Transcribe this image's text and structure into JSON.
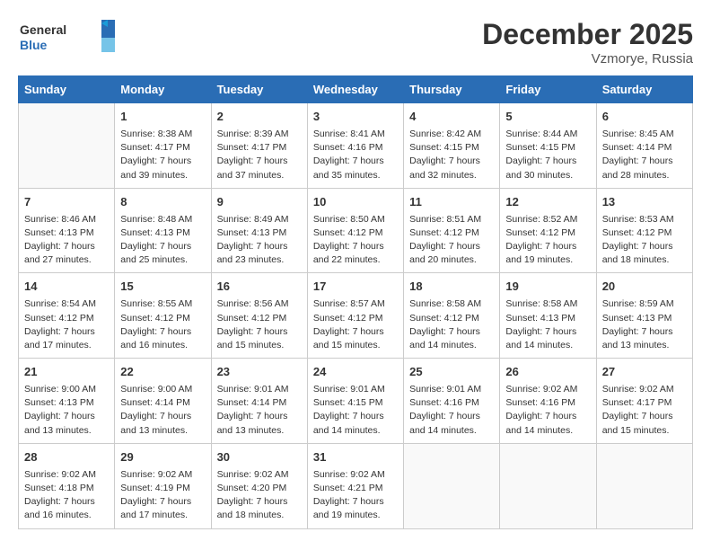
{
  "logo": {
    "line1": "General",
    "line2": "Blue"
  },
  "title": "December 2025",
  "location": "Vzmorye, Russia",
  "days_of_week": [
    "Sunday",
    "Monday",
    "Tuesday",
    "Wednesday",
    "Thursday",
    "Friday",
    "Saturday"
  ],
  "weeks": [
    [
      {
        "day": "",
        "info": ""
      },
      {
        "day": "1",
        "info": "Sunrise: 8:38 AM\nSunset: 4:17 PM\nDaylight: 7 hours\nand 39 minutes."
      },
      {
        "day": "2",
        "info": "Sunrise: 8:39 AM\nSunset: 4:17 PM\nDaylight: 7 hours\nand 37 minutes."
      },
      {
        "day": "3",
        "info": "Sunrise: 8:41 AM\nSunset: 4:16 PM\nDaylight: 7 hours\nand 35 minutes."
      },
      {
        "day": "4",
        "info": "Sunrise: 8:42 AM\nSunset: 4:15 PM\nDaylight: 7 hours\nand 32 minutes."
      },
      {
        "day": "5",
        "info": "Sunrise: 8:44 AM\nSunset: 4:15 PM\nDaylight: 7 hours\nand 30 minutes."
      },
      {
        "day": "6",
        "info": "Sunrise: 8:45 AM\nSunset: 4:14 PM\nDaylight: 7 hours\nand 28 minutes."
      }
    ],
    [
      {
        "day": "7",
        "info": "Sunrise: 8:46 AM\nSunset: 4:13 PM\nDaylight: 7 hours\nand 27 minutes."
      },
      {
        "day": "8",
        "info": "Sunrise: 8:48 AM\nSunset: 4:13 PM\nDaylight: 7 hours\nand 25 minutes."
      },
      {
        "day": "9",
        "info": "Sunrise: 8:49 AM\nSunset: 4:13 PM\nDaylight: 7 hours\nand 23 minutes."
      },
      {
        "day": "10",
        "info": "Sunrise: 8:50 AM\nSunset: 4:12 PM\nDaylight: 7 hours\nand 22 minutes."
      },
      {
        "day": "11",
        "info": "Sunrise: 8:51 AM\nSunset: 4:12 PM\nDaylight: 7 hours\nand 20 minutes."
      },
      {
        "day": "12",
        "info": "Sunrise: 8:52 AM\nSunset: 4:12 PM\nDaylight: 7 hours\nand 19 minutes."
      },
      {
        "day": "13",
        "info": "Sunrise: 8:53 AM\nSunset: 4:12 PM\nDaylight: 7 hours\nand 18 minutes."
      }
    ],
    [
      {
        "day": "14",
        "info": "Sunrise: 8:54 AM\nSunset: 4:12 PM\nDaylight: 7 hours\nand 17 minutes."
      },
      {
        "day": "15",
        "info": "Sunrise: 8:55 AM\nSunset: 4:12 PM\nDaylight: 7 hours\nand 16 minutes."
      },
      {
        "day": "16",
        "info": "Sunrise: 8:56 AM\nSunset: 4:12 PM\nDaylight: 7 hours\nand 15 minutes."
      },
      {
        "day": "17",
        "info": "Sunrise: 8:57 AM\nSunset: 4:12 PM\nDaylight: 7 hours\nand 15 minutes."
      },
      {
        "day": "18",
        "info": "Sunrise: 8:58 AM\nSunset: 4:12 PM\nDaylight: 7 hours\nand 14 minutes."
      },
      {
        "day": "19",
        "info": "Sunrise: 8:58 AM\nSunset: 4:13 PM\nDaylight: 7 hours\nand 14 minutes."
      },
      {
        "day": "20",
        "info": "Sunrise: 8:59 AM\nSunset: 4:13 PM\nDaylight: 7 hours\nand 13 minutes."
      }
    ],
    [
      {
        "day": "21",
        "info": "Sunrise: 9:00 AM\nSunset: 4:13 PM\nDaylight: 7 hours\nand 13 minutes."
      },
      {
        "day": "22",
        "info": "Sunrise: 9:00 AM\nSunset: 4:14 PM\nDaylight: 7 hours\nand 13 minutes."
      },
      {
        "day": "23",
        "info": "Sunrise: 9:01 AM\nSunset: 4:14 PM\nDaylight: 7 hours\nand 13 minutes."
      },
      {
        "day": "24",
        "info": "Sunrise: 9:01 AM\nSunset: 4:15 PM\nDaylight: 7 hours\nand 14 minutes."
      },
      {
        "day": "25",
        "info": "Sunrise: 9:01 AM\nSunset: 4:16 PM\nDaylight: 7 hours\nand 14 minutes."
      },
      {
        "day": "26",
        "info": "Sunrise: 9:02 AM\nSunset: 4:16 PM\nDaylight: 7 hours\nand 14 minutes."
      },
      {
        "day": "27",
        "info": "Sunrise: 9:02 AM\nSunset: 4:17 PM\nDaylight: 7 hours\nand 15 minutes."
      }
    ],
    [
      {
        "day": "28",
        "info": "Sunrise: 9:02 AM\nSunset: 4:18 PM\nDaylight: 7 hours\nand 16 minutes."
      },
      {
        "day": "29",
        "info": "Sunrise: 9:02 AM\nSunset: 4:19 PM\nDaylight: 7 hours\nand 17 minutes."
      },
      {
        "day": "30",
        "info": "Sunrise: 9:02 AM\nSunset: 4:20 PM\nDaylight: 7 hours\nand 18 minutes."
      },
      {
        "day": "31",
        "info": "Sunrise: 9:02 AM\nSunset: 4:21 PM\nDaylight: 7 hours\nand 19 minutes."
      },
      {
        "day": "",
        "info": ""
      },
      {
        "day": "",
        "info": ""
      },
      {
        "day": "",
        "info": ""
      }
    ]
  ]
}
